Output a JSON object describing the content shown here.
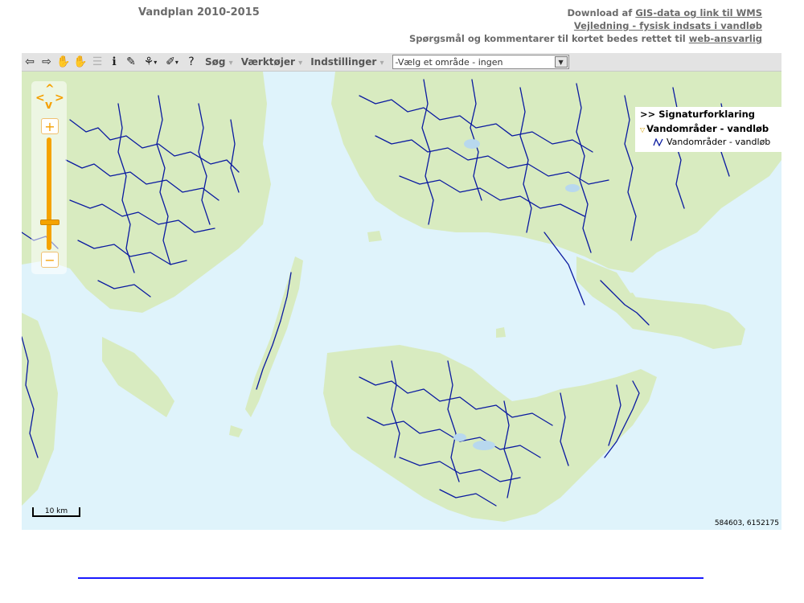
{
  "header": {
    "title": "Vandplan 2010-2015",
    "download_prefix": "Download af ",
    "download_link": "GIS-data og link til WMS",
    "guide_link": "Vejledning - fysisk indsats i vandløb",
    "contact_prefix": "Spørgsmål og kommentarer til kortet bedes rettet til ",
    "contact_link": "web-ansvarlig"
  },
  "toolbar": {
    "icons": [
      "back-arrow-icon",
      "forward-arrow-icon",
      "pan-hand-icon",
      "select-hand-icon",
      "list-icon",
      "info-icon",
      "measure-pen-icon",
      "select-features-icon",
      "draw-tools-icon",
      "help-icon"
    ],
    "menus": {
      "search": "Søg",
      "tools": "Værktøjer",
      "settings": "Indstillinger"
    },
    "area_select": "-Vælg et område - ingen"
  },
  "map": {
    "water_color": "#dff3fb",
    "land_color": "#d8ebc0",
    "river_color": "#0a1aa0",
    "scale_label": "10 km",
    "coordinates": "584603, 6152175"
  },
  "legend": {
    "header": ">> Signaturforklaring",
    "layer_name": "Vandområder - vandløb",
    "item_label": "Vandområder - vandløb"
  }
}
